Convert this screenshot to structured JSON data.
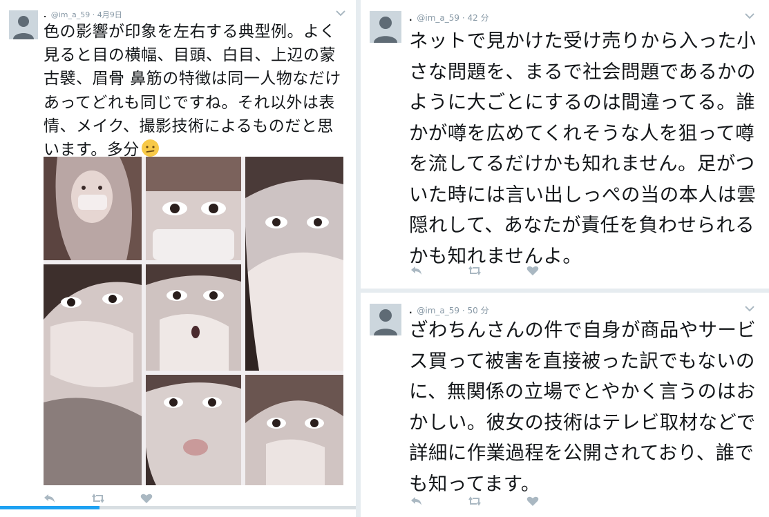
{
  "tweets": [
    {
      "name_prefix": ".",
      "handle": "@im_a_59",
      "time": "4月9日",
      "text": "色の影響が印象を左右する典型例。よく見ると目の横幅、目頭、白目、上辺の蒙古襞、眉骨 鼻筋の特徴は同一人物なだけあってどれも同じですね。それ以外は表情、メイク、撮影技術によるものだと思います。多分",
      "emoji": "confused-face-emoji",
      "media_progress": 0.28
    },
    {
      "name_prefix": ".",
      "handle": "@im_a_59",
      "time": "42 分",
      "text": "ネットで見かけた受け売りから入った小さな問題を、まるで社会問題であるかのように大ごとにするのは間違ってる。誰かが噂を広めてくれそうな人を狙って噂を流してるだけかも知れません。足がついた時には言い出しっぺの当の本人は雲隠れして、あなたが責任を負わせられるかも知れませんよ。"
    },
    {
      "name_prefix": ".",
      "handle": "@im_a_59",
      "time": "50 分",
      "text": "ざわちんさんの件で自身が商品やサービス買って被害を直接被った訳でもないのに、無関係の立場でとやかく言うのはおかしい。彼女の技術はテレビ取材などで詳細に作業過程を公開されており、誰でも知ってます。"
    }
  ],
  "icons": {
    "reply": "reply-icon",
    "retweet": "retweet-icon",
    "like": "heart-icon",
    "more": "chevron-down-icon",
    "avatar": "default-avatar-icon"
  },
  "colors": {
    "icon_gray": "#aab8c2",
    "accent": "#1da1f2",
    "text": "#14171a",
    "meta": "#8899a6"
  }
}
